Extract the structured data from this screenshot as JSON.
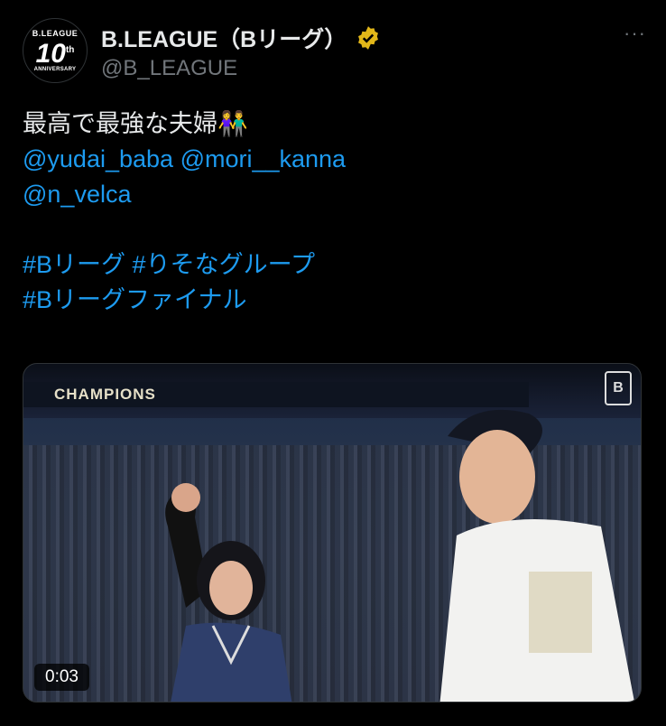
{
  "author": {
    "name": "B.LEAGUE（Bリーグ）",
    "handle": "@B_LEAGUE",
    "avatar": {
      "line1": "B.LEAGUE",
      "line2": "10",
      "line2_sup": "th",
      "line3": "ANNIVERSARY"
    },
    "verified_color": "#e2b719"
  },
  "more_label": "···",
  "post": {
    "text_line1": "最高で最強な夫婦👫",
    "mention1": "@yudai_baba",
    "mention2": "@mori__kanna",
    "mention3": "@n_velca",
    "hashtag1": "#Bリーグ",
    "hashtag2": "#りそなグループ",
    "hashtag3": "#Bリーグファイナル",
    "link_color": "#1d9bf0"
  },
  "media": {
    "banner_text": "CHAMPIONS",
    "logo_text": "B",
    "duration": "0:03"
  }
}
